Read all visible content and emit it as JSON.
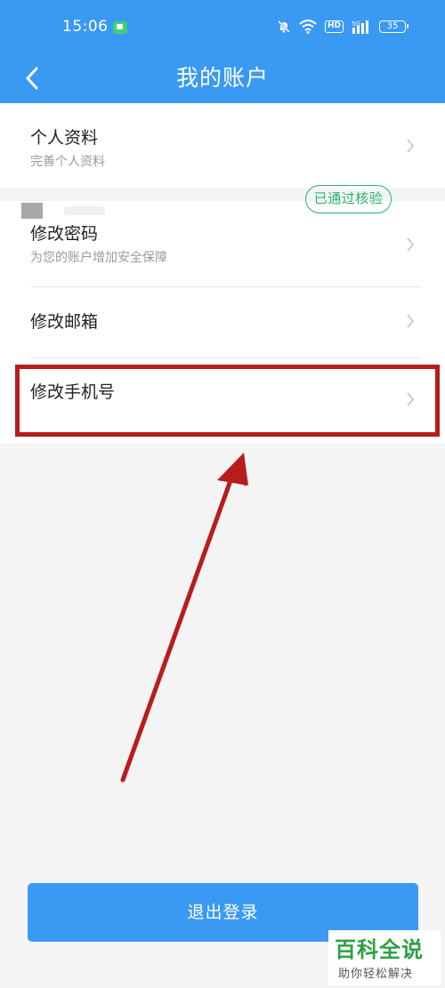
{
  "status_bar": {
    "time": "15:06",
    "hd_label": "HD",
    "battery": "35",
    "icons": [
      "chat-icon",
      "bell-mute-icon",
      "wifi-icon",
      "hd-icon",
      "signal-icon",
      "battery-icon"
    ]
  },
  "header": {
    "title": "我的账户",
    "back_icon": "back-arrow-icon"
  },
  "sections": [
    {
      "rows": [
        {
          "title": "个人资料",
          "subtitle": "完善个人资料"
        }
      ]
    },
    {
      "rows": [
        {
          "title": "修改密码",
          "subtitle": "为您的账户增加安全保障"
        },
        {
          "title": "修改邮箱"
        },
        {
          "title": "修改手机号",
          "badge": "已通过核验"
        }
      ]
    }
  ],
  "logout": {
    "label": "退出登录"
  },
  "watermark": {
    "title": "百科全说",
    "subtitle": "助你轻松解决"
  },
  "colors": {
    "primary": "#3a99f2",
    "badge_green": "#27b36a",
    "annotation_red": "#b81c1c",
    "background": "#f4f4f4"
  }
}
